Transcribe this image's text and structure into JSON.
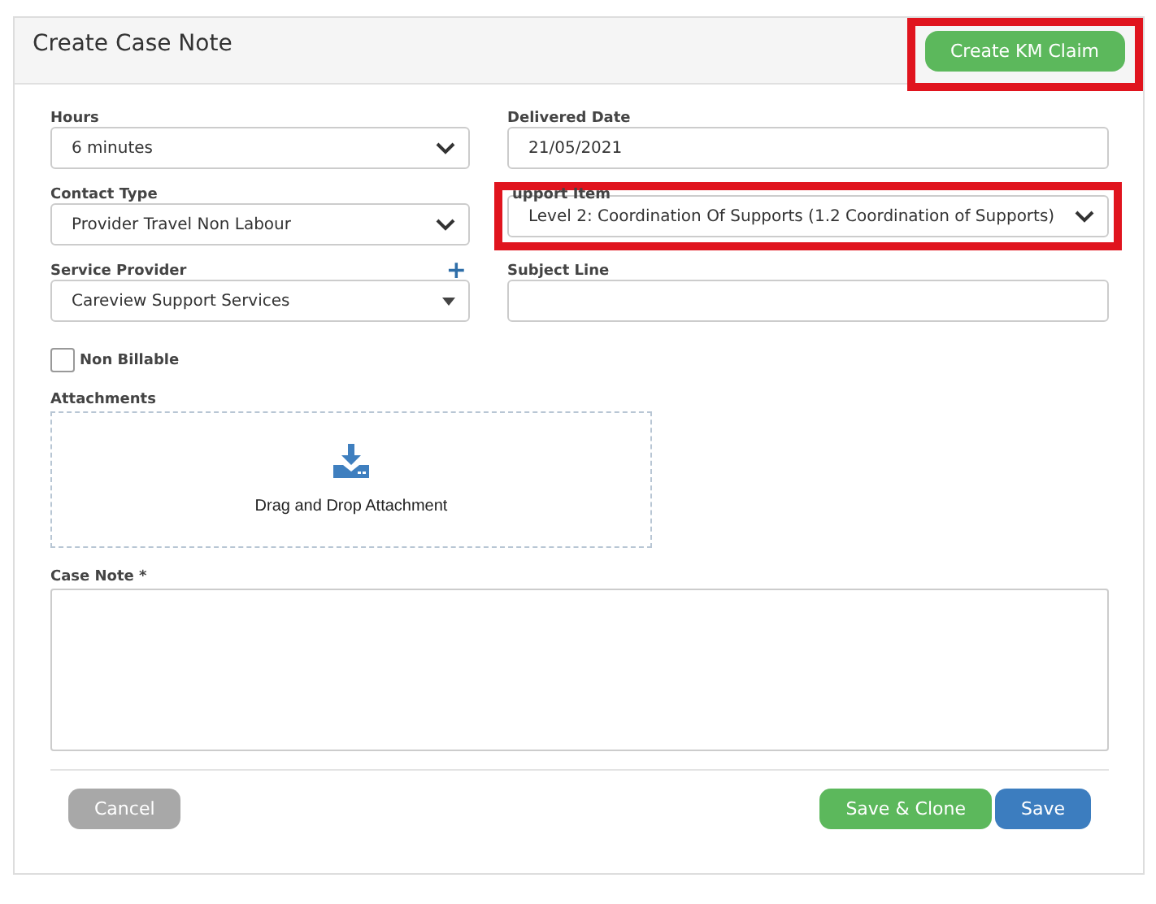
{
  "header": {
    "title": "Create Case Note",
    "action": {
      "label": "Create KM Claim",
      "highlighted": true
    }
  },
  "fields": [
    {
      "kind": "select",
      "label": "Hours",
      "value": "6 minutes",
      "highlighted": false
    },
    {
      "kind": "text",
      "label": "Delivered Date",
      "value": "21/05/2021",
      "highlighted": false
    },
    {
      "kind": "select",
      "label": "Contact Type",
      "value": "Provider Travel Non Labour",
      "highlighted": false
    },
    {
      "kind": "select",
      "label": "upport Item",
      "value": "Level 2: Coordination Of Supports (1.2 Coordination of Supports)",
      "highlighted": true
    },
    {
      "kind": "dropdown",
      "label": "Service Provider",
      "value": "Careview Support Services",
      "highlighted": false,
      "add": "+"
    },
    {
      "kind": "text",
      "label": "Subject Line",
      "highlighted": false
    }
  ],
  "non_billable": {
    "label": "Non Billable",
    "checked": false
  },
  "attachments": {
    "label": "Attachments",
    "hint": "Drag and Drop Attachment"
  },
  "case_note": {
    "label": "Case Note *"
  },
  "buttons": [
    {
      "kind": "cancel",
      "label": "Cancel",
      "disabled": true
    },
    {
      "kind": "clone",
      "label": "Save & Clone",
      "disabled": false
    },
    {
      "kind": "save",
      "label": "Save",
      "disabled": false
    }
  ]
}
